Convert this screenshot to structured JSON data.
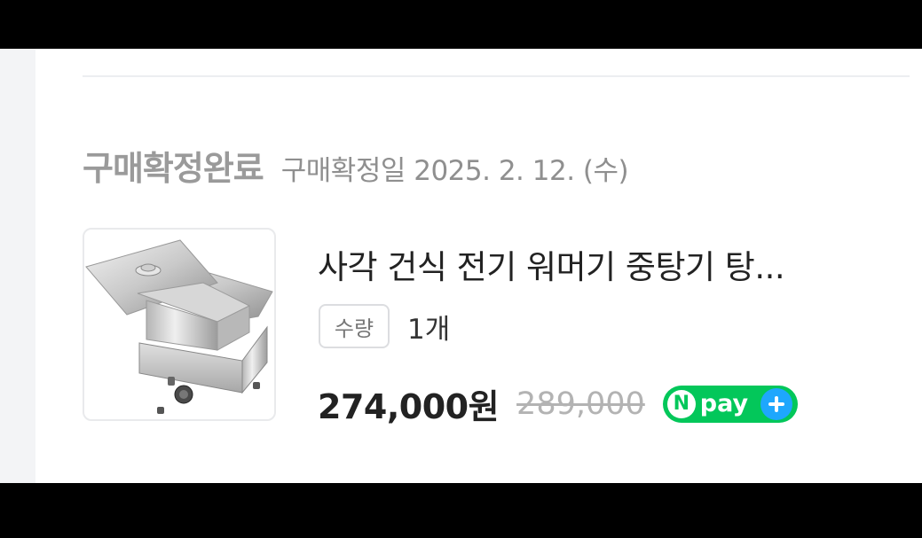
{
  "order": {
    "status_title": "구매확정완료",
    "confirm_date": "구매확정일 2025. 2. 12. (수)"
  },
  "product": {
    "name": "사각 건식 전기 워머기 중탕기 탕...",
    "image_icon": "food-warmer-image",
    "quantity_label": "수량",
    "quantity_value": "1개",
    "price": "274,000원",
    "original_price": "289,000",
    "npay_badge": {
      "n": "N",
      "text": "pay",
      "colors": {
        "badge": "#03c75a",
        "plus": "#1ea7fd"
      }
    }
  }
}
